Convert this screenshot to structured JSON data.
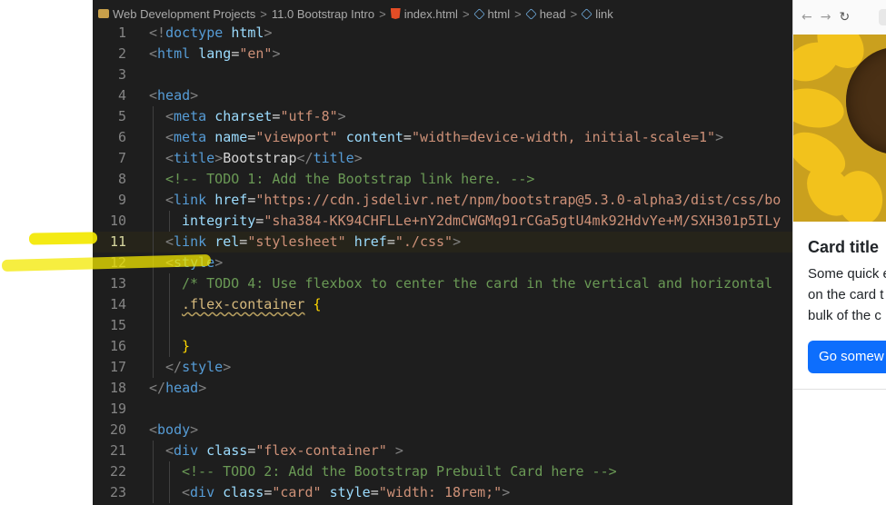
{
  "breadcrumb": {
    "items": [
      "Web Development Projects",
      "11.0 Bootstrap Intro",
      "index.html",
      "html",
      "head",
      "link"
    ],
    "separator": ">"
  },
  "editor": {
    "active_line": 11,
    "lines": [
      {
        "n": "1",
        "indent": 0,
        "tokens": [
          [
            "punc",
            "<!"
          ],
          [
            "tag",
            "doctype"
          ],
          [
            "text",
            " "
          ],
          [
            "attr",
            "html"
          ],
          [
            "punc",
            ">"
          ]
        ]
      },
      {
        "n": "2",
        "indent": 0,
        "tokens": [
          [
            "punc",
            "<"
          ],
          [
            "tag",
            "html"
          ],
          [
            "text",
            " "
          ],
          [
            "attr",
            "lang"
          ],
          [
            "text",
            "="
          ],
          [
            "str",
            "\"en\""
          ],
          [
            "punc",
            ">"
          ]
        ]
      },
      {
        "n": "3",
        "indent": 0,
        "tokens": []
      },
      {
        "n": "4",
        "indent": 0,
        "tokens": [
          [
            "punc",
            "<"
          ],
          [
            "tag",
            "head"
          ],
          [
            "punc",
            ">"
          ]
        ]
      },
      {
        "n": "5",
        "indent": 1,
        "tokens": [
          [
            "punc",
            "<"
          ],
          [
            "tag",
            "meta"
          ],
          [
            "text",
            " "
          ],
          [
            "attr",
            "charset"
          ],
          [
            "text",
            "="
          ],
          [
            "str",
            "\"utf-8\""
          ],
          [
            "punc",
            ">"
          ]
        ]
      },
      {
        "n": "6",
        "indent": 1,
        "tokens": [
          [
            "punc",
            "<"
          ],
          [
            "tag",
            "meta"
          ],
          [
            "text",
            " "
          ],
          [
            "attr",
            "name"
          ],
          [
            "text",
            "="
          ],
          [
            "str",
            "\"viewport\""
          ],
          [
            "text",
            " "
          ],
          [
            "attr",
            "content"
          ],
          [
            "text",
            "="
          ],
          [
            "str",
            "\"width=device-width, initial-scale=1\""
          ],
          [
            "punc",
            ">"
          ]
        ]
      },
      {
        "n": "7",
        "indent": 1,
        "tokens": [
          [
            "punc",
            "<"
          ],
          [
            "tag",
            "title"
          ],
          [
            "punc",
            ">"
          ],
          [
            "text",
            "Bootstrap"
          ],
          [
            "punc",
            "</"
          ],
          [
            "tag",
            "title"
          ],
          [
            "punc",
            ">"
          ]
        ]
      },
      {
        "n": "8",
        "indent": 1,
        "tokens": [
          [
            "com",
            "<!-- TODO 1: Add the Bootstrap link here. -->"
          ]
        ]
      },
      {
        "n": "9",
        "indent": 1,
        "tokens": [
          [
            "punc",
            "<"
          ],
          [
            "tag",
            "link"
          ],
          [
            "text",
            " "
          ],
          [
            "attr",
            "href"
          ],
          [
            "text",
            "="
          ],
          [
            "str",
            "\"https://cdn.jsdelivr.net/npm/bootstrap@5.3.0-alpha3/dist/css/bo"
          ]
        ]
      },
      {
        "n": "10",
        "indent": 2,
        "tokens": [
          [
            "attr",
            "integrity"
          ],
          [
            "text",
            "="
          ],
          [
            "str",
            "\"sha384-KK94CHFLLe+nY2dmCWGMq91rCGa5gtU4mk92HdvYe+M/SXH301p5ILy"
          ]
        ]
      },
      {
        "n": "11",
        "indent": 1,
        "tokens": [
          [
            "punc",
            "<"
          ],
          [
            "tag",
            "link"
          ],
          [
            "text",
            " "
          ],
          [
            "attr",
            "rel"
          ],
          [
            "text",
            "="
          ],
          [
            "str",
            "\"stylesheet\""
          ],
          [
            "text",
            " "
          ],
          [
            "attr",
            "href"
          ],
          [
            "text",
            "="
          ],
          [
            "str",
            "\"./css\""
          ],
          [
            "punc",
            ">"
          ]
        ]
      },
      {
        "n": "12",
        "indent": 1,
        "tokens": [
          [
            "punc",
            "<"
          ],
          [
            "tag",
            "style"
          ],
          [
            "punc",
            ">"
          ]
        ]
      },
      {
        "n": "13",
        "indent": 2,
        "tokens": [
          [
            "com",
            "/* TODO 4: Use flexbox to center the card in the vertical and horizontal"
          ]
        ]
      },
      {
        "n": "14",
        "indent": 2,
        "tokens": [
          [
            "sel",
            ".flex-container"
          ],
          [
            "text",
            " "
          ],
          [
            "brace",
            "{"
          ]
        ]
      },
      {
        "n": "15",
        "indent": 2,
        "tokens": []
      },
      {
        "n": "16",
        "indent": 2,
        "tokens": [
          [
            "brace",
            "}"
          ]
        ]
      },
      {
        "n": "17",
        "indent": 1,
        "tokens": [
          [
            "punc",
            "</"
          ],
          [
            "tag",
            "style"
          ],
          [
            "punc",
            ">"
          ]
        ]
      },
      {
        "n": "18",
        "indent": 0,
        "tokens": [
          [
            "punc",
            "</"
          ],
          [
            "tag",
            "head"
          ],
          [
            "punc",
            ">"
          ]
        ]
      },
      {
        "n": "19",
        "indent": 0,
        "tokens": []
      },
      {
        "n": "20",
        "indent": 0,
        "tokens": [
          [
            "punc",
            "<"
          ],
          [
            "tag",
            "body"
          ],
          [
            "punc",
            ">"
          ]
        ]
      },
      {
        "n": "21",
        "indent": 1,
        "tokens": [
          [
            "punc",
            "<"
          ],
          [
            "tag",
            "div"
          ],
          [
            "text",
            " "
          ],
          [
            "attr",
            "class"
          ],
          [
            "text",
            "="
          ],
          [
            "str",
            "\"flex-container\""
          ],
          [
            "text",
            " "
          ],
          [
            "punc",
            ">"
          ]
        ]
      },
      {
        "n": "22",
        "indent": 2,
        "tokens": [
          [
            "com",
            "<!-- TODO 2: Add the Bootstrap Prebuilt Card here -->"
          ]
        ]
      },
      {
        "n": "23",
        "indent": 2,
        "tokens": [
          [
            "punc",
            "<"
          ],
          [
            "tag",
            "div"
          ],
          [
            "text",
            " "
          ],
          [
            "attr",
            "class"
          ],
          [
            "text",
            "="
          ],
          [
            "str",
            "\"card\""
          ],
          [
            "text",
            " "
          ],
          [
            "attr",
            "style"
          ],
          [
            "text",
            "="
          ],
          [
            "str",
            "\"width: 18rem;\""
          ],
          [
            "punc",
            ">"
          ]
        ]
      }
    ]
  },
  "colors": {
    "editor_bg": "#1e1e1e",
    "tag": "#569cd6",
    "attr": "#9cdcfe",
    "string": "#ce9178",
    "comment": "#6a9955",
    "highlighter": "#f3e800",
    "button_primary": "#0d6efd"
  },
  "browser": {
    "nav_icons": [
      "back-arrow-icon",
      "forward-arrow-icon",
      "reload-icon"
    ],
    "nav_glyphs": {
      "back": "←",
      "forward": "→",
      "reload": "↻"
    },
    "card": {
      "title": "Card title",
      "text_lines": [
        "Some quick e",
        "on the card t",
        "bulk of the c"
      ],
      "button_label": "Go somew"
    }
  }
}
